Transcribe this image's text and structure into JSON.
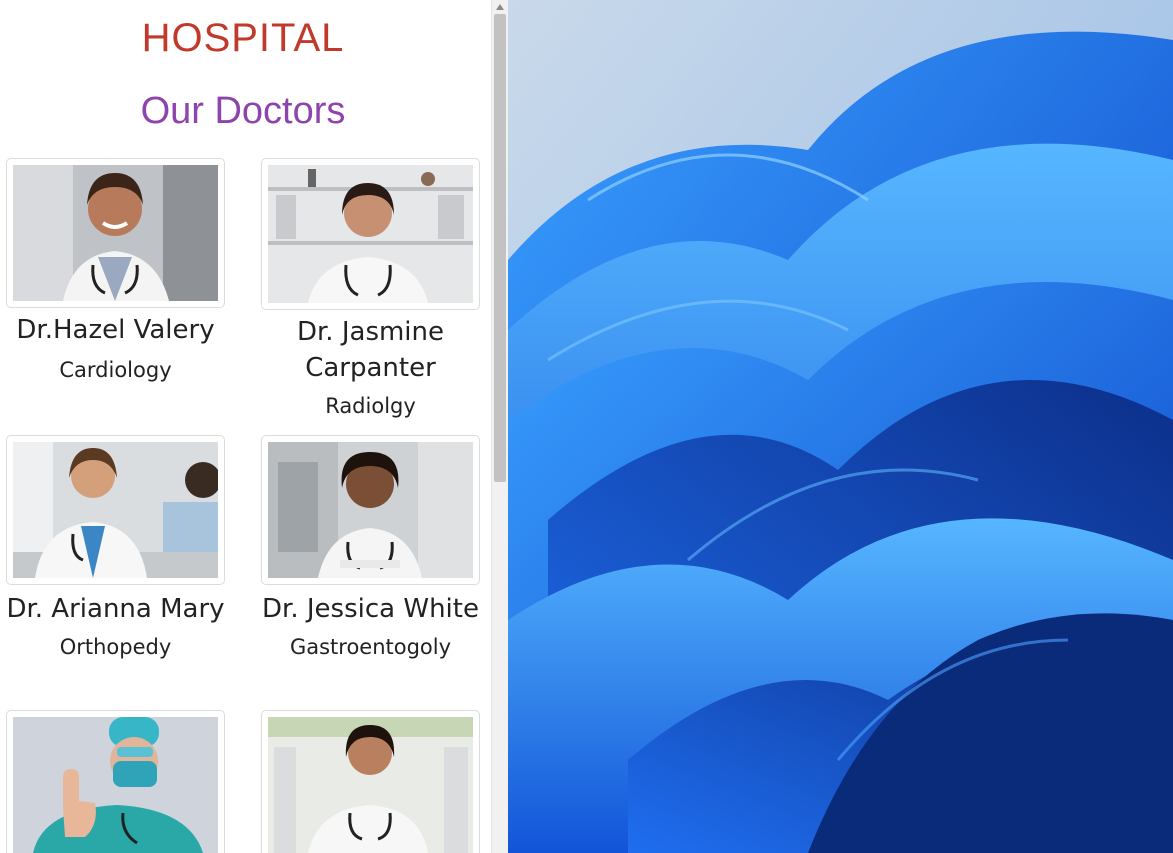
{
  "header": {
    "title": "HOSPITAL",
    "section_title": "Our Doctors"
  },
  "doctors": [
    {
      "name": "Dr.Hazel Valery",
      "specialty": "Cardiology",
      "photo_icon": "doctor-photo"
    },
    {
      "name": "Dr. Jasmine Carpanter",
      "specialty": "Radiolgy",
      "photo_icon": "doctor-photo"
    },
    {
      "name": "Dr. Arianna Mary",
      "specialty": "Orthopedy",
      "photo_icon": "doctor-photo"
    },
    {
      "name": "Dr. Jessica White",
      "specialty": "Gastroentogoly",
      "photo_icon": "doctor-photo"
    },
    {
      "name": "",
      "specialty": "",
      "photo_icon": "surgeon-photo"
    },
    {
      "name": "",
      "specialty": "",
      "photo_icon": "doctor-photo"
    }
  ],
  "colors": {
    "title": "#c0392b",
    "section_title": "#8e44ad",
    "wallpaper": "#1a4fd6"
  }
}
